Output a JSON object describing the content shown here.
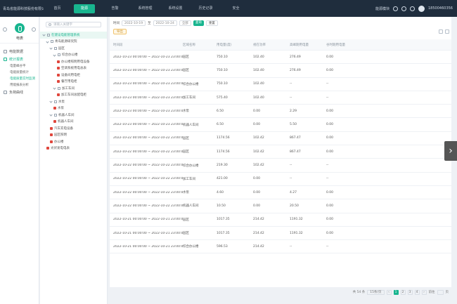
{
  "app": {
    "brand": "青岛省能源科技股份有限公司",
    "nav": [
      "首页",
      "能源",
      "告警",
      "系统管理",
      "系统设置",
      "历史记录",
      "安全"
    ],
    "active_nav_index": 1,
    "user_menu": "能源模块",
    "account": "18500460356"
  },
  "rail": {
    "title": "电表",
    "menu": [
      {
        "label": "电能数据",
        "active": false
      },
      {
        "label": "统计报表",
        "active": true
      },
      {
        "label": "负荷曲线",
        "active": false
      }
    ],
    "subs": [
      "电量峰谷平",
      "电能质量统计",
      "电能质量实时监测",
      "用能报表分析"
    ],
    "active_sub_index": 2
  },
  "tree": {
    "search_placeholder": "请输入关键字",
    "nodes": [
      {
        "label": "在建设电能管理系统",
        "kind": "dir",
        "level": 0
      },
      {
        "label": "青岛能源研究院",
        "kind": "dir",
        "level": 1
      },
      {
        "label": "园区",
        "kind": "dir",
        "level": 2
      },
      {
        "label": "综合办公楼",
        "kind": "dir",
        "level": 3
      },
      {
        "label": "办公楼照明用电设备",
        "kind": "dev",
        "level": 4
      },
      {
        "label": "空调系统用电总表",
        "kind": "dev",
        "level": 4
      },
      {
        "label": "设备间用电柜",
        "kind": "dev",
        "level": 4
      },
      {
        "label": "餐厅用电柜",
        "kind": "dev",
        "level": 4
      },
      {
        "label": "加工车间",
        "kind": "dir",
        "level": 3
      },
      {
        "label": "加工车间总配电柜",
        "kind": "dev",
        "level": 4
      },
      {
        "label": "水泵",
        "kind": "dir",
        "level": 2
      },
      {
        "label": "水泵",
        "kind": "dev",
        "level": 3
      },
      {
        "label": "机器人车间",
        "kind": "dir",
        "level": 2
      },
      {
        "label": "机器人车间",
        "kind": "dev",
        "level": 3
      },
      {
        "label": "汽车充电设备",
        "kind": "dev",
        "level": 2
      },
      {
        "label": "园区照明",
        "kind": "dev",
        "level": 2
      },
      {
        "label": "办公楼",
        "kind": "dev",
        "level": 2
      },
      {
        "label": "光伏发电电表",
        "kind": "dev",
        "level": 1
      }
    ],
    "selected_index": 0
  },
  "filters": {
    "label": "时间",
    "start": "2022-10-19",
    "sep": "至",
    "end": "2022-10-24",
    "type": "全部",
    "query": "查询",
    "reset": "重置",
    "export": "导出"
  },
  "table": {
    "headers": [
      "时间段",
      "区域名称",
      "用电量(度)",
      "视在功率",
      "高峰期用电量",
      "谷时期用电量"
    ],
    "rows": [
      [
        "2022-10-23 00:00:00 ~ 2022-10-23 23:00:00",
        "园区",
        "750.10",
        "102.40",
        "276.49",
        "0.00"
      ],
      [
        "2022-10-23 00:00:00 ~ 2022-10-23 23:00:00",
        "园区",
        "750.10",
        "102.40",
        "276.49",
        "0.00"
      ],
      [
        "2022-10-23 00:00:00 ~ 2022-10-23 23:00:00",
        "综合办公楼",
        "750.10",
        "102.40",
        "--",
        "--"
      ],
      [
        "2022-10-23 00:00:00 ~ 2022-10-23 23:00:00",
        "加工车间",
        "575.40",
        "102.40",
        "--",
        "--"
      ],
      [
        "2022-10-23 00:00:00 ~ 2022-10-23 23:00:00",
        "水泵",
        "6.50",
        "0.00",
        "2.29",
        "0.00"
      ],
      [
        "2022-10-23 00:00:00 ~ 2022-10-23 23:00:00",
        "机器人车间",
        "6.50",
        "0.00",
        "5.50",
        "0.00"
      ],
      [
        "2022-10-22 00:00:00 ~ 2022-10-22 23:00:00",
        "园区",
        "1174.56",
        "102.42",
        "867.47",
        "0.00"
      ],
      [
        "2022-10-22 00:00:00 ~ 2022-10-22 23:00:00",
        "园区",
        "1174.56",
        "102.42",
        "867.47",
        "0.00"
      ],
      [
        "2022-10-22 00:00:00 ~ 2022-10-22 23:00:00",
        "综合办公楼",
        "219.30",
        "102.42",
        "--",
        "--"
      ],
      [
        "2022-10-22 00:00:00 ~ 2022-10-22 23:00:00",
        "加工车间",
        "421.00",
        "0.00",
        "--",
        "--"
      ],
      [
        "2022-10-22 00:00:00 ~ 2022-10-22 23:00:00",
        "水泵",
        "4.60",
        "0.00",
        "4.27",
        "0.00"
      ],
      [
        "2022-10-22 00:00:00 ~ 2022-10-22 23:00:00",
        "机器人车间",
        "10.50",
        "0.00",
        "20.50",
        "0.00"
      ],
      [
        "2022-10-21 00:00:00 ~ 2022-10-21 23:00:00",
        "园区",
        "1017.35",
        "214.42",
        "1191.32",
        "0.00"
      ],
      [
        "2022-10-21 00:00:00 ~ 2022-10-21 23:00:00",
        "园区",
        "1017.35",
        "214.42",
        "1191.32",
        "0.00"
      ],
      [
        "2022-10-21 00:00:00 ~ 2022-10-21 23:00:00",
        "综合办公楼",
        "596.53",
        "214.42",
        "--",
        "--"
      ]
    ]
  },
  "pager": {
    "total": "共 54 条",
    "page_size": "15条/页",
    "pages": [
      "1",
      "2",
      "3",
      "4"
    ],
    "current": "1",
    "goto": "前往",
    "page_unit": "页"
  },
  "colors": {
    "accent": "#18b58f",
    "topbar": "#1f2d3d"
  }
}
